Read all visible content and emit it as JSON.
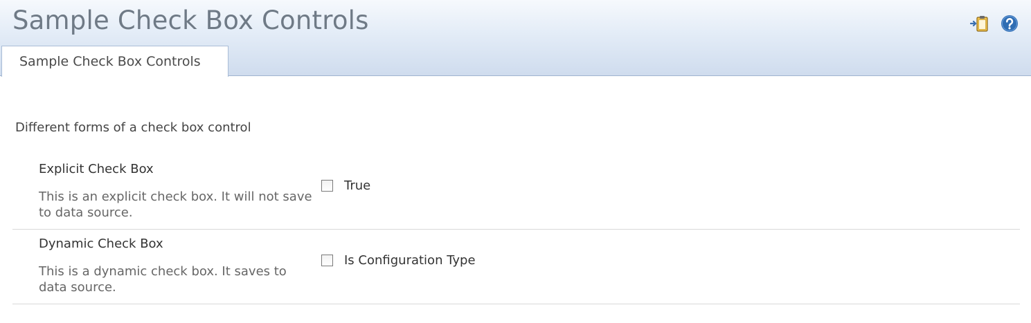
{
  "header": {
    "title": "Sample Check Box Controls",
    "icons": [
      "add-to-clipboard-icon",
      "help-icon"
    ],
    "accent_color": "#2f6db3"
  },
  "tabs": [
    {
      "label": "Sample Check Box Controls",
      "selected": true
    }
  ],
  "section": {
    "description": "Different forms of a check box control"
  },
  "fields": [
    {
      "label": "Explicit Check Box",
      "help": "This is an explicit check box. It will not save to data source.",
      "checkbox_label": "True",
      "checked": false
    },
    {
      "label": "Dynamic Check Box",
      "help": "This is a dynamic check box. It saves to data source.",
      "checkbox_label": "Is Configuration Type",
      "checked": false
    }
  ]
}
